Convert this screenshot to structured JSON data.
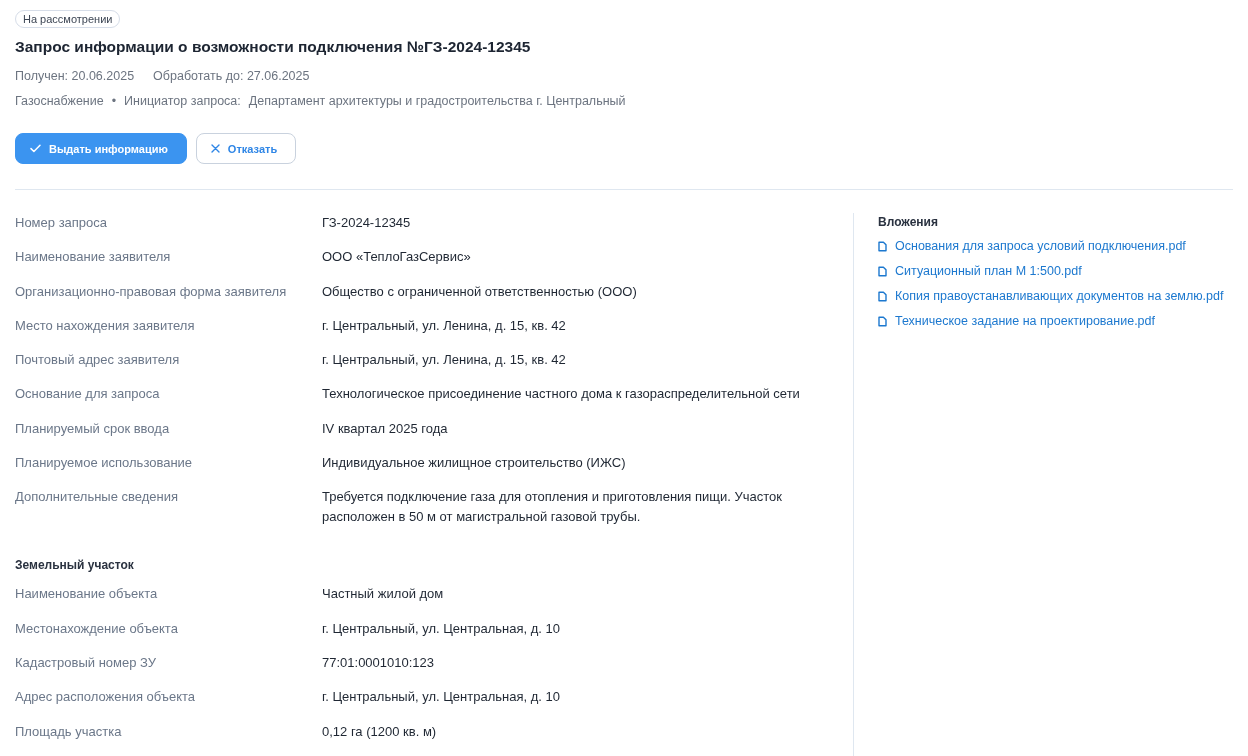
{
  "status_badge": "На рассмотрении",
  "title": "Запрос информации о возможности подключения №ГЗ-2024-12345",
  "dates": {
    "received": "Получен: 20.06.2025",
    "deadline": "Обработать до: 27.06.2025"
  },
  "meta": {
    "category": "Газоснабжение",
    "separator": "•",
    "initiator_label": "Инициатор запроса:",
    "initiator": "Департамент архитектуры и градостроительства г. Центральный"
  },
  "actions": [
    {
      "kind": "primary",
      "label": "Выдать информацию"
    },
    {
      "kind": "secondary",
      "label": "Отказать"
    }
  ],
  "details": {
    "rows": [
      {
        "label": "Номер запроса",
        "value": "ГЗ-2024-12345"
      },
      {
        "label": "Наименование заявителя",
        "value": "ООО «ТеплоГазСервис»"
      },
      {
        "label": "Организационно-правовая форма заявителя",
        "value": "Общество с ограниченной ответственностью (ООО)"
      },
      {
        "label": "Место нахождения заявителя",
        "value": "г. Центральный, ул. Ленина, д. 15, кв. 42"
      },
      {
        "label": "Почтовый адрес заявителя",
        "value": "г. Центральный, ул. Ленина, д. 15, кв. 42"
      },
      {
        "label": "Основание для запроса",
        "value": "Технологическое присоединение частного дома к газораспределительной сети"
      },
      {
        "label": "Планируемый срок ввода",
        "value": "IV квартал 2025 года"
      },
      {
        "label": "Планируемое использование",
        "value": "Индивидуальное жилищное строительство (ИЖС)"
      },
      {
        "label": "Дополнительные сведения",
        "value": "Требуется подключение газа для отопления и приготовления пищи. Участок расположен в 50 м от магистральной газовой трубы."
      }
    ],
    "sections": [
      {
        "title": "Земельный участок",
        "rows": [
          {
            "label": "Наименование объекта",
            "value": "Частный жилой дом"
          },
          {
            "label": "Местонахождение объекта",
            "value": "г. Центральный, ул. Центральная, д. 10"
          },
          {
            "label": "Кадастровый номер ЗУ",
            "value": "77:01:0001010:123"
          },
          {
            "label": "Адрес расположения объекта",
            "value": "г. Центральный, ул. Центральная, д. 10"
          },
          {
            "label": "Площадь участка",
            "value": "0,12 га (1200 кв. м)"
          }
        ]
      }
    ]
  },
  "attachments": {
    "title": "Вложения",
    "files": [
      "Основания для запроса условий подключения.pdf",
      "Ситуационный план М 1:500.pdf",
      "Копия правоустанавливающих документов на землю.pdf",
      "Техническое задание на проектирование.pdf"
    ]
  }
}
